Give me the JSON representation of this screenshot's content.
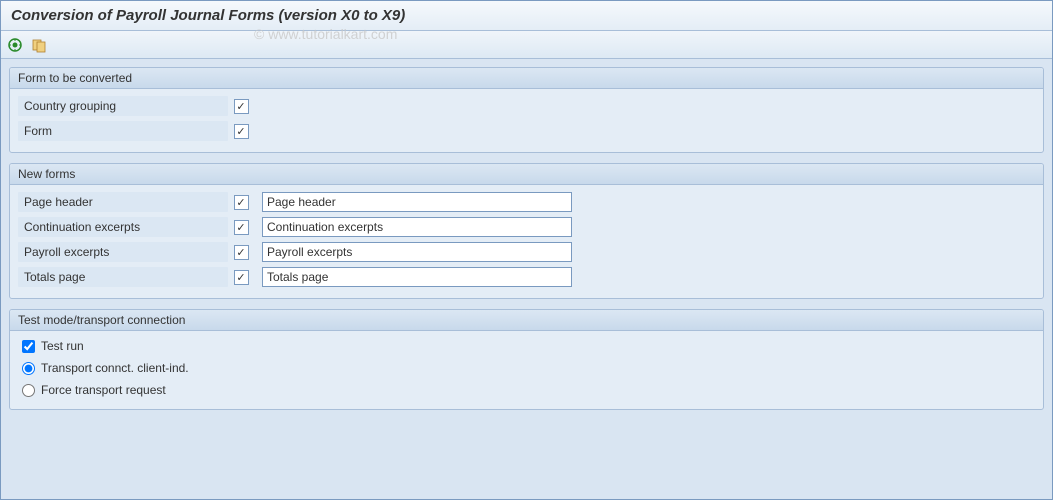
{
  "title": "Conversion of Payroll Journal Forms (version X0 to X9)",
  "watermark": "© www.tutorialkart.com",
  "group1": {
    "header": "Form to be converted",
    "row1_label": "Country grouping",
    "row2_label": "Form"
  },
  "group2": {
    "header": "New forms",
    "rows": [
      {
        "label": "Page header",
        "value": "Page header"
      },
      {
        "label": "Continuation excerpts",
        "value": "Continuation excerpts"
      },
      {
        "label": "Payroll excerpts",
        "value": "Payroll excerpts"
      },
      {
        "label": "Totals page",
        "value": "Totals page"
      }
    ]
  },
  "group3": {
    "header": "Test mode/transport connection",
    "test_run": "Test run",
    "opt1": "Transport connct. client-ind.",
    "opt2": "Force transport request"
  }
}
